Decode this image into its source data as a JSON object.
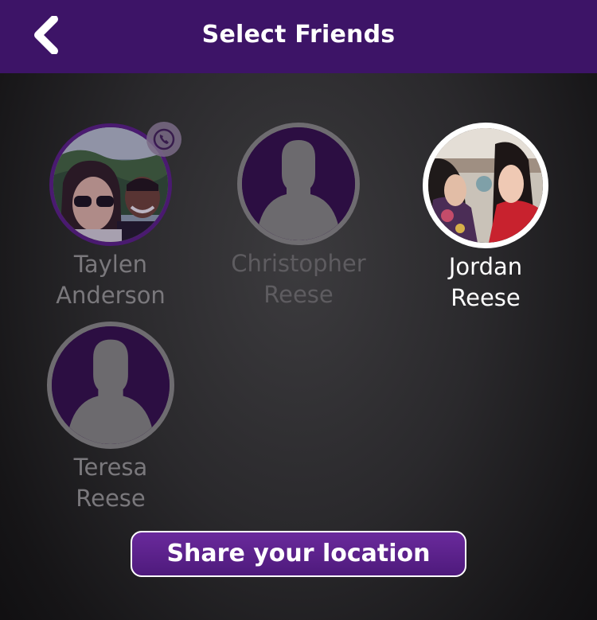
{
  "header": {
    "title": "Select Friends",
    "back_icon": "chevron-left-icon"
  },
  "friends": [
    {
      "first": "Taylen",
      "last": "Anderson",
      "avatar": "photo",
      "selected": false,
      "badge": "viber-phone-icon"
    },
    {
      "first": "Christopher",
      "last": "Reese",
      "avatar": "placeholder",
      "selected": false
    },
    {
      "first": "Jordan",
      "last": "Reese",
      "avatar": "photo",
      "selected": true
    },
    {
      "first": "Teresa",
      "last": "Reese",
      "avatar": "placeholder",
      "selected": false
    }
  ],
  "share_button": {
    "label": "Share your location"
  },
  "colors": {
    "header_bg": "#3d1467",
    "accent": "#5a2088",
    "selected_text": "#ffffff",
    "unselected_text": "#7a787c"
  }
}
